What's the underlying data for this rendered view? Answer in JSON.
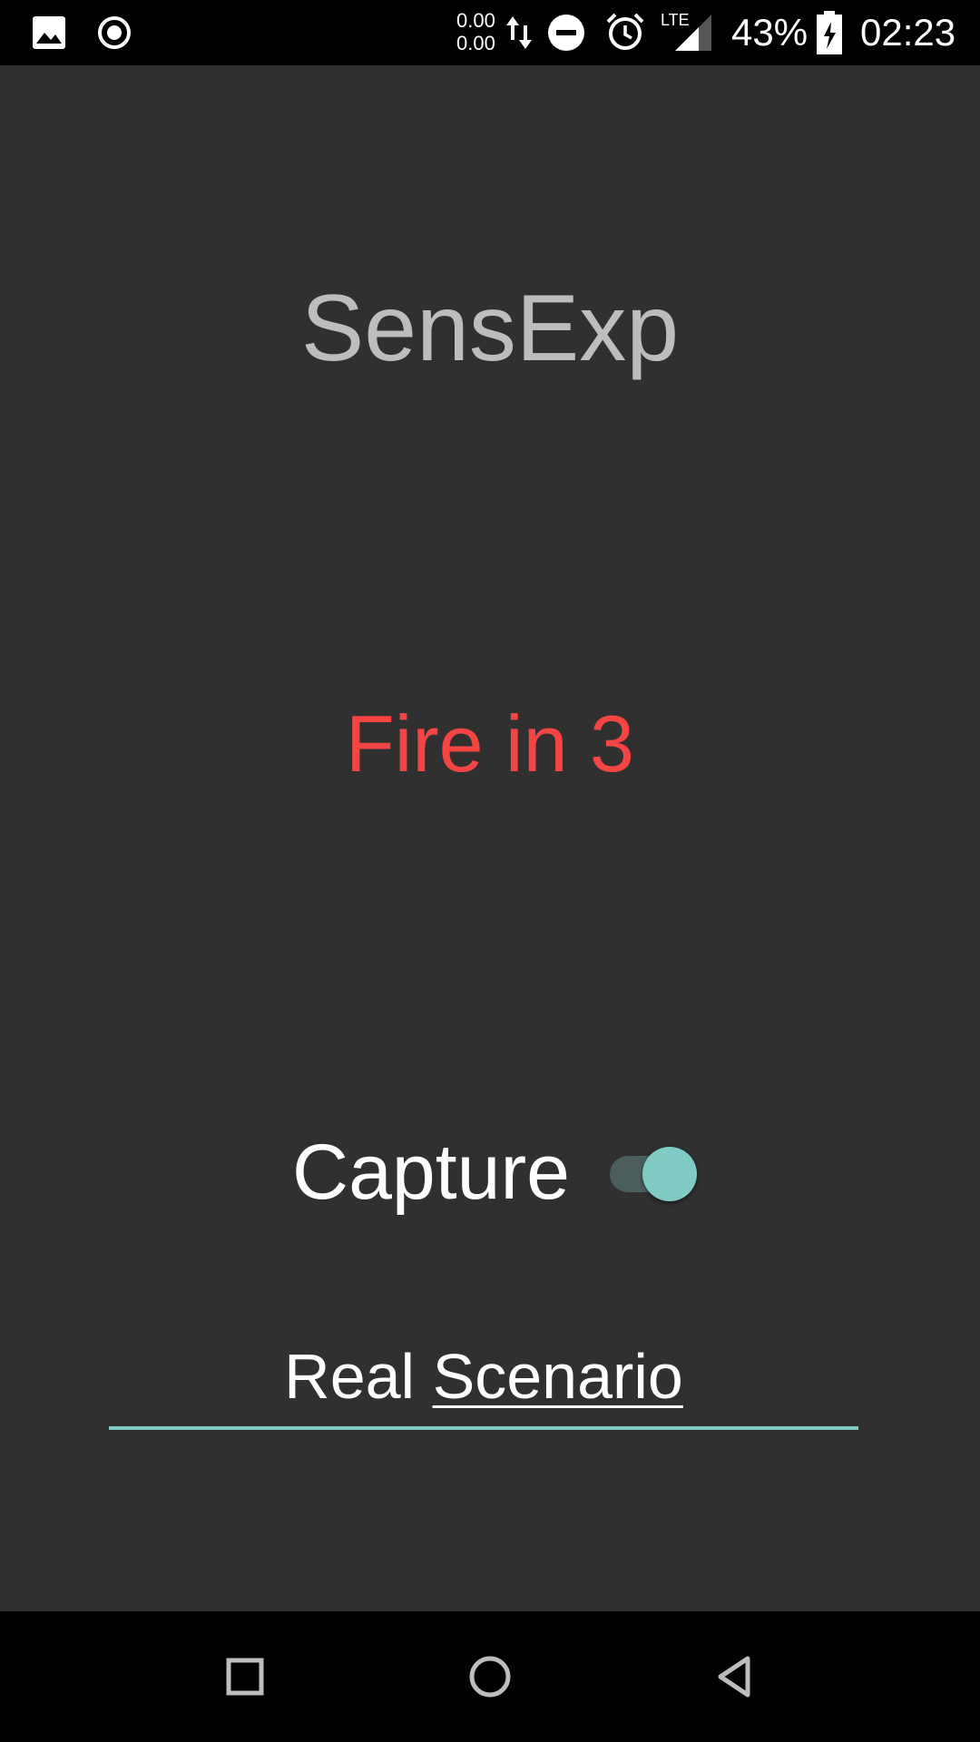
{
  "status_bar": {
    "net_up": "0.00",
    "net_down": "0.00",
    "network_type": "LTE",
    "battery_percent": "43%",
    "time": "02:23",
    "icons": [
      "image-icon",
      "record-icon",
      "data-transfer-icon",
      "dnd-icon",
      "alarm-icon",
      "signal-icon",
      "battery-charging-icon"
    ]
  },
  "main": {
    "app_title": "SensExp",
    "fire_status": "Fire in 3",
    "capture_label": "Capture",
    "capture_switch": {
      "checked": true,
      "track_color": "#4a5f5d",
      "thumb_color": "#80cbc4"
    },
    "scenario_input": {
      "word1": "Real",
      "word2": "Scenario",
      "underline_color": "#80cbc4"
    }
  },
  "colors": {
    "background": "#303030",
    "title": "#bdbdbd",
    "fire": "#f44444",
    "accent": "#80cbc4"
  },
  "nav_bar": {
    "icons": [
      "recents-icon",
      "home-icon",
      "back-icon"
    ]
  }
}
